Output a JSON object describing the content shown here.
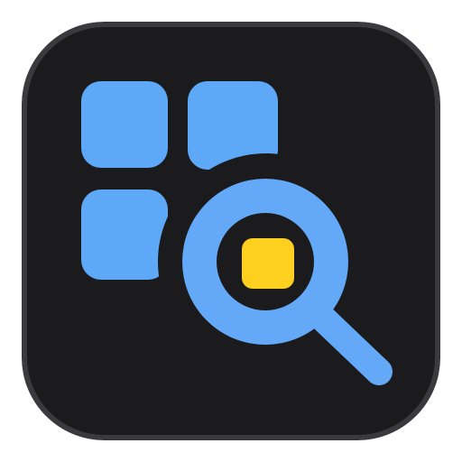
{
  "app_icon": {
    "name": "grid-search-app-icon",
    "colors": {
      "border": "#3a3a3e",
      "background": "#1b1b1d",
      "tile": "#5ea8f8",
      "magnifier": "#64a9f7",
      "lens_inner": "#1b1b1d",
      "highlight": "#fdd01f"
    },
    "icons": [
      "grid-tile-icon",
      "magnifying-glass-icon",
      "highlighted-square-icon"
    ]
  }
}
